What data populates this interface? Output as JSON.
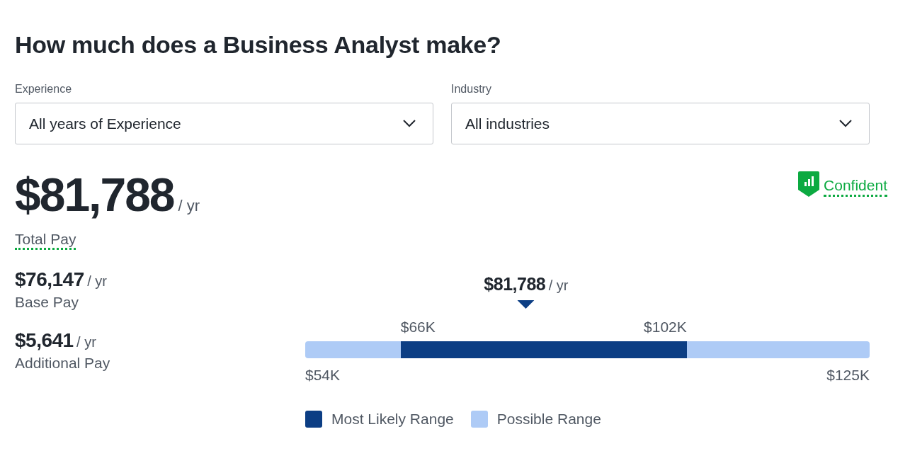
{
  "title": "How much does a Business Analyst make?",
  "filters": [
    {
      "label": "Experience",
      "value": "All years of Experience"
    },
    {
      "label": "Industry",
      "value": "All industries"
    }
  ],
  "confidence": {
    "label": "Confident"
  },
  "total": {
    "amount": "$81,788",
    "unit": "/ yr",
    "label": "Total Pay"
  },
  "breakdown": [
    {
      "amount": "$76,147",
      "unit": "/ yr",
      "label": "Base Pay"
    },
    {
      "amount": "$5,641",
      "unit": "/ yr",
      "label": "Additional Pay"
    }
  ],
  "range": {
    "median": {
      "amount": "$81,788",
      "unit": "/ yr"
    },
    "likely_low": "$66K",
    "likely_high": "$102K",
    "min": "$54K",
    "max": "$125K"
  },
  "legend": [
    {
      "label": "Most Likely Range",
      "color": "#0c3e84"
    },
    {
      "label": "Possible Range",
      "color": "#aecbf6"
    }
  ]
}
